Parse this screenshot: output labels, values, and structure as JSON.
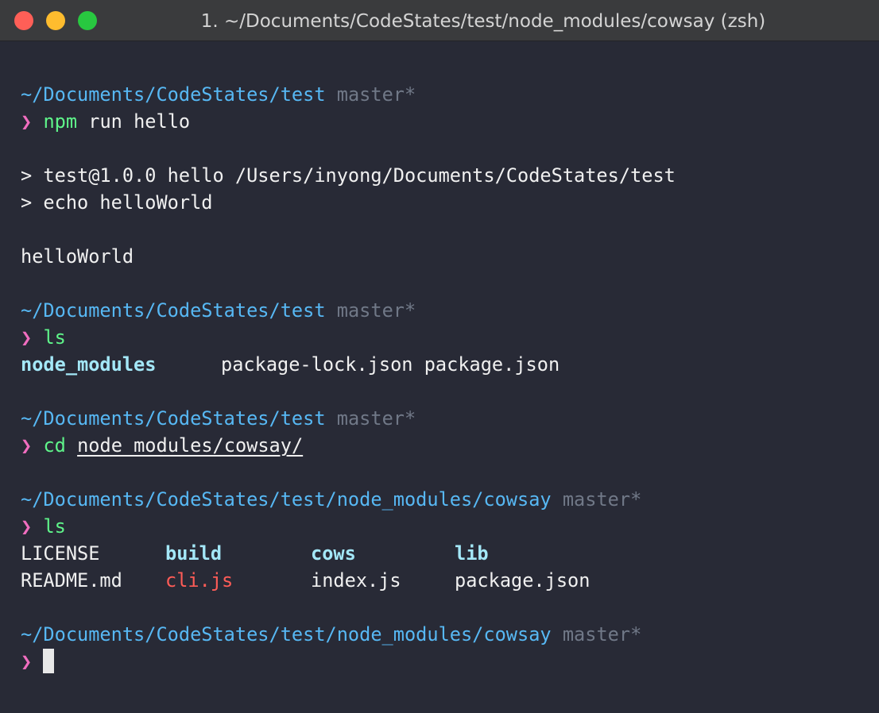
{
  "window": {
    "title": "1. ~/Documents/CodeStates/test/node_modules/cowsay (zsh)",
    "close_icon": "close-icon",
    "minimize_icon": "minimize-icon",
    "zoom_icon": "zoom-icon"
  },
  "terminal": {
    "prompt_symbol": "❯",
    "path_test": "~/Documents/CodeStates/test",
    "path_cowsay": "~/Documents/CodeStates/test/node_modules/cowsay",
    "git_branch": "master*",
    "commands": {
      "npm": "npm",
      "run_hello": " run hello",
      "ls": "ls",
      "cd": "cd",
      "cd_arg": "node_modules/cowsay/"
    },
    "npm_output": {
      "line1": "> test@1.0.0 hello /Users/inyong/Documents/CodeStates/test",
      "line2": "> echo helloWorld",
      "result": "helloWorld"
    },
    "ls_test": {
      "node_modules": "node_modules",
      "package_lock": "package-lock.json",
      "package_json": "package.json"
    },
    "ls_cowsay": {
      "row1": [
        "LICENSE",
        "build",
        "cows",
        "lib"
      ],
      "row2": [
        "README.md",
        "cli.js",
        "index.js",
        "package.json"
      ]
    }
  },
  "colors": {
    "background": "#282a36",
    "path": "#57b8f4",
    "git": "#707887",
    "prompt": "#f06dbf",
    "command": "#5ff58a",
    "directory": "#a4e8f8",
    "executable": "#ff5c57"
  }
}
